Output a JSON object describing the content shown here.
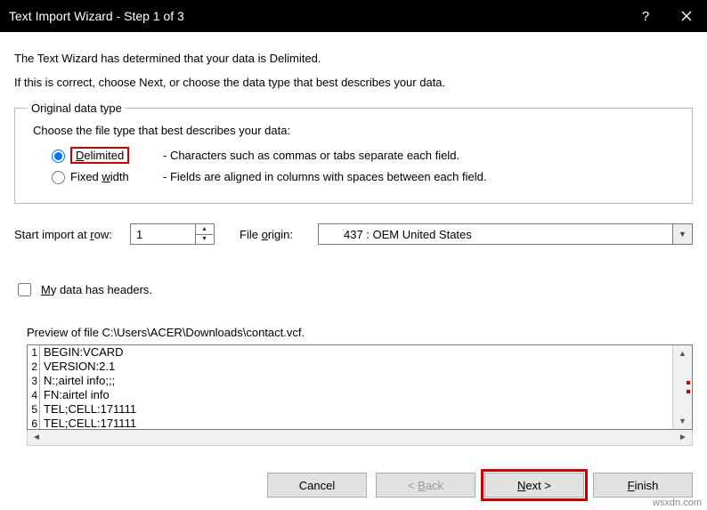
{
  "titlebar": {
    "title": "Text Import Wizard - Step 1 of 3"
  },
  "intro1": "The Text Wizard has determined that your data is Delimited.",
  "intro2": "If this is correct, choose Next, or choose the data type that best describes your data.",
  "fieldset": {
    "legend": "Original data type",
    "prompt": "Choose the file type that best describes your data:",
    "delimited": {
      "label": "Delimited",
      "desc": "- Characters such as commas or tabs separate each field."
    },
    "fixed": {
      "label": "Fixed width",
      "desc": "- Fields are aligned in columns with spaces between each field."
    }
  },
  "start_row": {
    "label": "Start import at row:",
    "value": "1"
  },
  "file_origin": {
    "label": "File origin:",
    "value": "437 : OEM United States"
  },
  "headers_chk": "My data has headers.",
  "preview": {
    "label": "Preview of file C:\\Users\\ACER\\Downloads\\contact.vcf.",
    "lines": [
      "BEGIN:VCARD",
      "VERSION:2.1",
      "N:;airtel info;;;",
      "FN:airtel info",
      "TEL;CELL:171111",
      "TEL;CELL:171111"
    ]
  },
  "buttons": {
    "cancel": "Cancel",
    "back": "< Back",
    "next": "Next >",
    "finish": "Finish"
  },
  "watermark": "wsxdn.com"
}
